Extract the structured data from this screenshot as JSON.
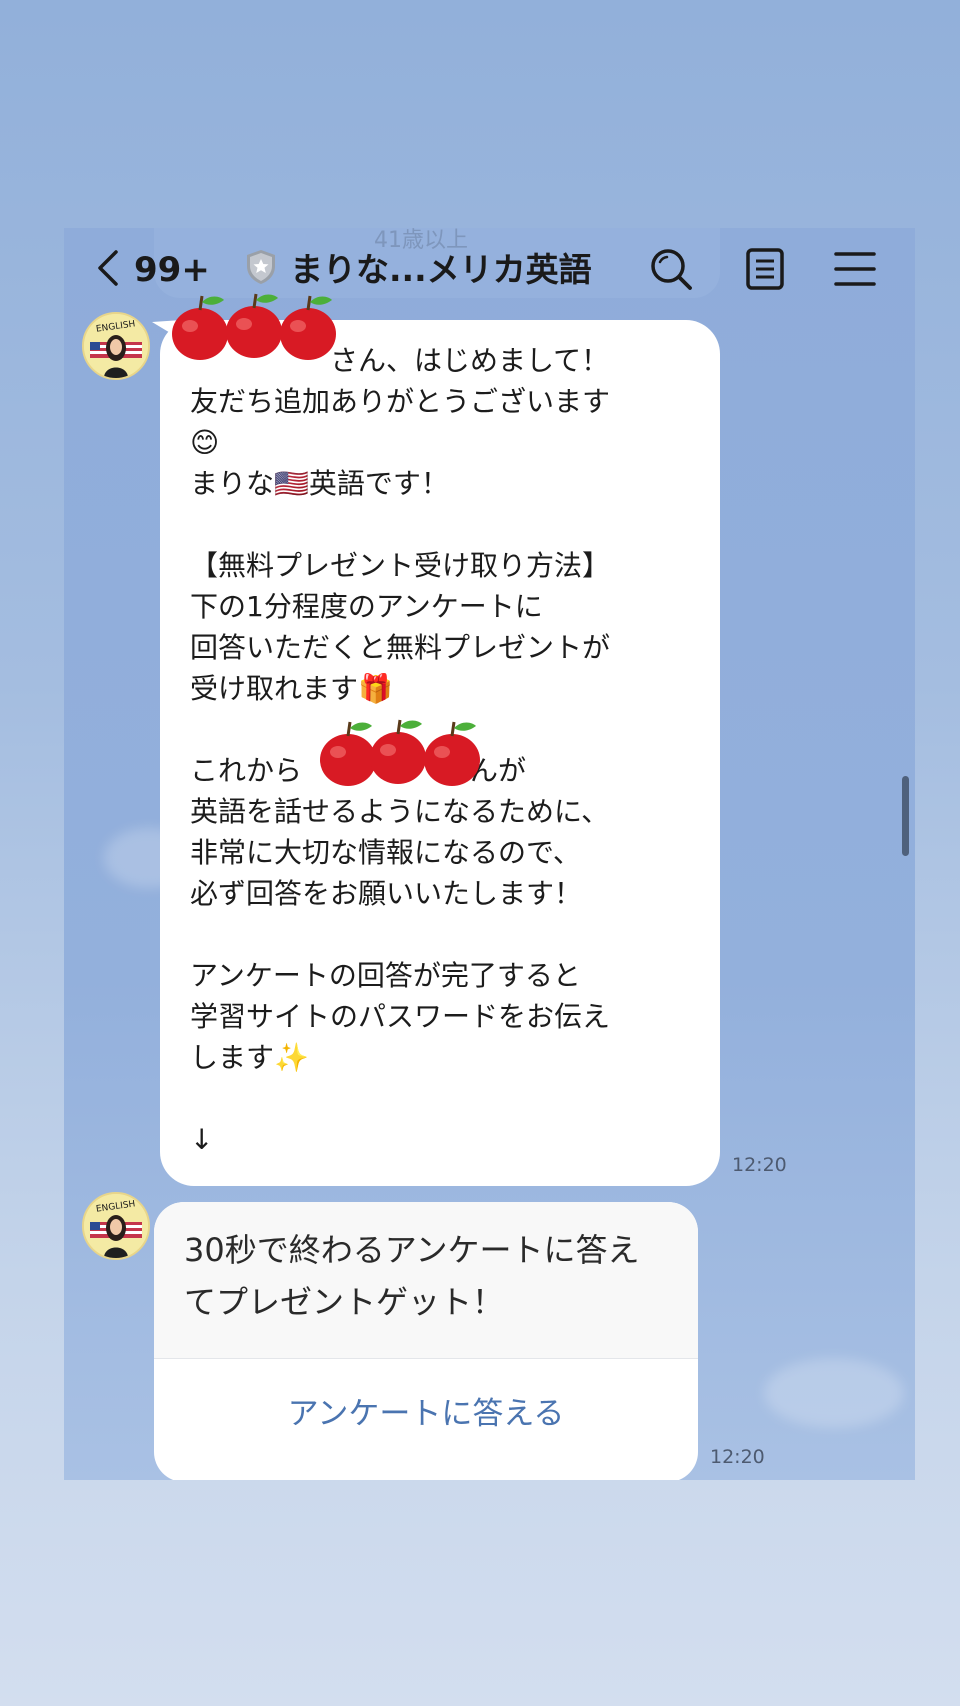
{
  "header": {
    "unread_count": "99+",
    "title": "まりな...メリカ英語",
    "ghost_text": "41歳以上"
  },
  "messages": [
    {
      "text": "　　　　　さん、はじめまして！\n友だち追加ありがとうございます\n😊\nまりな🇺🇸英語です！\n\n【無料プレゼント受け取り方法】\n下の1分程度のアンケートに\n回答いただくと無料プレゼントが\n受け取れます🎁\n\nこれから　　　　　さんが\n英語を話せるようになるために、\n非常に大切な情報になるので、\n必ず回答をお願いいたします！\n\nアンケートの回答が完了すると\n学習サイトのパスワードをお伝え\nします✨\n\n↓",
      "time": "12:20"
    }
  ],
  "card": {
    "text": "30秒で終わるアンケートに答えてプレゼントゲット！",
    "button_label": "アンケートに答える",
    "time": "12:20"
  },
  "avatar": {
    "text": "ENGLISH"
  },
  "colors": {
    "background": "#92b0da",
    "chat_background": "#8facda",
    "bubble": "#ffffff",
    "card_link": "#4a74b0"
  }
}
